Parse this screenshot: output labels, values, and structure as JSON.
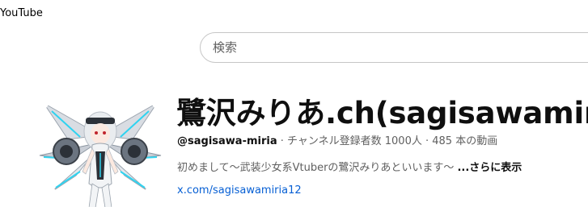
{
  "nav": {
    "logo_label": "YouTube"
  },
  "search": {
    "placeholder": "検索",
    "value": ""
  },
  "channel": {
    "title": "鷺沢みりあ.ch(sagisawamiria)",
    "handle": "@sagisawa-miria",
    "separator": " · ",
    "subscribers": "チャンネル登録者数 1000人",
    "videos": "485 本の動画",
    "description": "初めまして〜武装少女系Vtuberの鷺沢みりあといいます〜",
    "more_label": "...さらに表示",
    "link_text": "x.com/sagisawamiria12"
  },
  "colors": {
    "link": "#065fd4",
    "secondary_text": "#606060",
    "primary_text": "#0f0f0f",
    "search_border": "#c6c6c6"
  }
}
